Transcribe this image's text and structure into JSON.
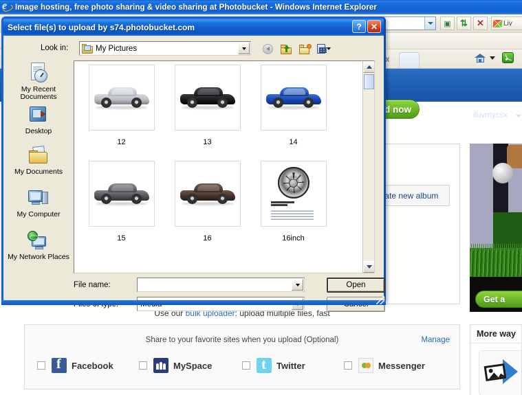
{
  "browser": {
    "title": "Image hosting, free photo sharing & video sharing at Photobucket - Windows Internet Explorer",
    "ie_icon": "internet-explorer-icon",
    "address_value": "",
    "toolbar_buttons": [
      {
        "name": "feeds-button",
        "glyph": "▤"
      },
      {
        "name": "refresh-button",
        "glyph": "↻"
      },
      {
        "name": "stop-button",
        "glyph": "✕"
      }
    ],
    "live_toolbar_label": "Liv",
    "tab_close_label": "x",
    "home_icon": "home-icon",
    "rss_icon": "rss-feed-icon"
  },
  "photobucket": {
    "upload_now_label": "d now",
    "username": "iluvmycsx",
    "create_album_label": "reate new album",
    "bulk": {
      "prefix": "Use our ",
      "link": "bulk uploader",
      "suffix": ": upload multiple files, fast"
    },
    "share": {
      "header": "Share to your favorite sites when you upload (Optional)",
      "manage_label": "Manage",
      "items": [
        {
          "label": "Facebook",
          "icon": "facebook-icon",
          "checked": false
        },
        {
          "label": "MySpace",
          "icon": "myspace-icon",
          "checked": false
        },
        {
          "label": "Twitter",
          "icon": "twitter-icon",
          "checked": false
        },
        {
          "label": "Messenger",
          "icon": "messenger-icon",
          "checked": false
        }
      ]
    },
    "ad": {
      "cta_label": "Get a"
    },
    "more_ways": {
      "title": "More way"
    }
  },
  "dialog": {
    "title": "Select file(s) to upload by s74.photobucket.com",
    "help_button": "?",
    "close_button": "✕",
    "lookin_label": "Look in:",
    "lookin_value": "My Pictures",
    "nav_icons": [
      {
        "name": "back-button",
        "title": "Back"
      },
      {
        "name": "up-one-level-button",
        "title": "Up One Level"
      },
      {
        "name": "create-new-folder-button",
        "title": "Create New Folder"
      },
      {
        "name": "views-button",
        "title": "Views"
      }
    ],
    "places": [
      {
        "label": "My Recent Documents",
        "icon": "recent-documents-icon"
      },
      {
        "label": "Desktop",
        "icon": "desktop-icon"
      },
      {
        "label": "My Documents",
        "icon": "my-documents-icon"
      },
      {
        "label": "My Computer",
        "icon": "my-computer-icon"
      },
      {
        "label": "My Network Places",
        "icon": "network-places-icon"
      }
    ],
    "files": [
      {
        "name": "12",
        "kind": "car",
        "color": "#b9bcc0",
        "dark": "#7e8288"
      },
      {
        "name": "13",
        "kind": "car",
        "color": "#191a1c",
        "dark": "#000000"
      },
      {
        "name": "14",
        "kind": "car",
        "color": "#1746b4",
        "dark": "#0e2f80"
      },
      {
        "name": "15",
        "kind": "car",
        "color": "#54545a",
        "dark": "#303036"
      },
      {
        "name": "16",
        "kind": "car",
        "color": "#46342c",
        "dark": "#241a15"
      },
      {
        "name": "16inch",
        "kind": "wheel-sheet",
        "color": "#ffffff",
        "dark": "#cccccc"
      }
    ],
    "filename_label": "File name:",
    "filename_value": "",
    "filetype_label": "Files of type:",
    "filetype_value": "Media",
    "open_label": "Open",
    "cancel_label": "Cancel"
  }
}
